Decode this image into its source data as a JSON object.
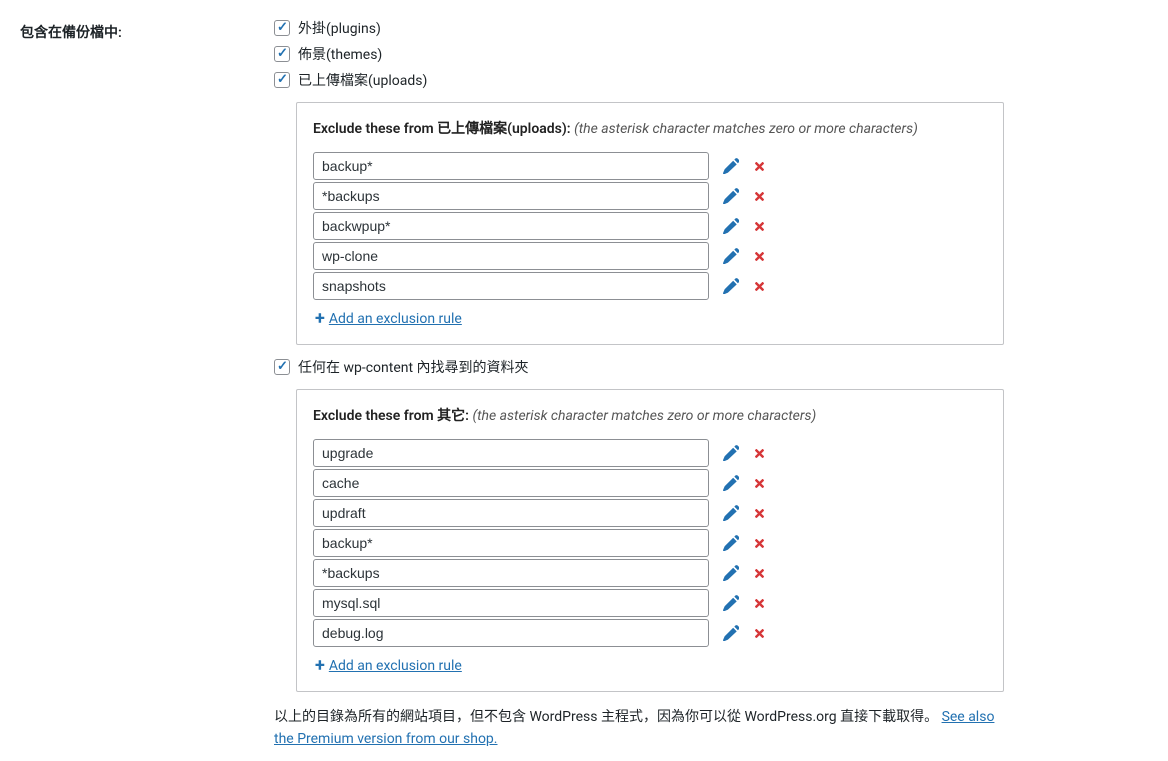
{
  "field_label": "包含在備份檔中:",
  "checkboxes": {
    "plugins": {
      "label": "外掛(plugins)",
      "checked": true
    },
    "themes": {
      "label": "佈景(themes)",
      "checked": true
    },
    "uploads": {
      "label": "已上傳檔案(uploads)",
      "checked": true
    },
    "wpcontent": {
      "label": "任何在 wp-content 內找尋到的資料夾",
      "checked": true
    }
  },
  "uploads_box": {
    "heading_prefix": "Exclude these from 已上傳檔案(uploads):",
    "hint": "(the asterisk character matches zero or more characters)",
    "rules": [
      "backup*",
      "*backups",
      "backwpup*",
      "wp-clone",
      "snapshots"
    ],
    "add_rule_label": "Add an exclusion rule"
  },
  "others_box": {
    "heading_prefix": "Exclude these from 其它:",
    "hint": "(the asterisk character matches zero or more characters)",
    "rules": [
      "upgrade",
      "cache",
      "updraft",
      "backup*",
      "*backups",
      "mysql.sql",
      "debug.log"
    ],
    "add_rule_label": "Add an exclusion rule"
  },
  "footer": {
    "text_before": "以上的目錄為所有的網站項目，但不包含 WordPress 主程式，因為你可以從 WordPress.org 直接下載取得。 ",
    "link_text": "See also the Premium version from our shop."
  }
}
